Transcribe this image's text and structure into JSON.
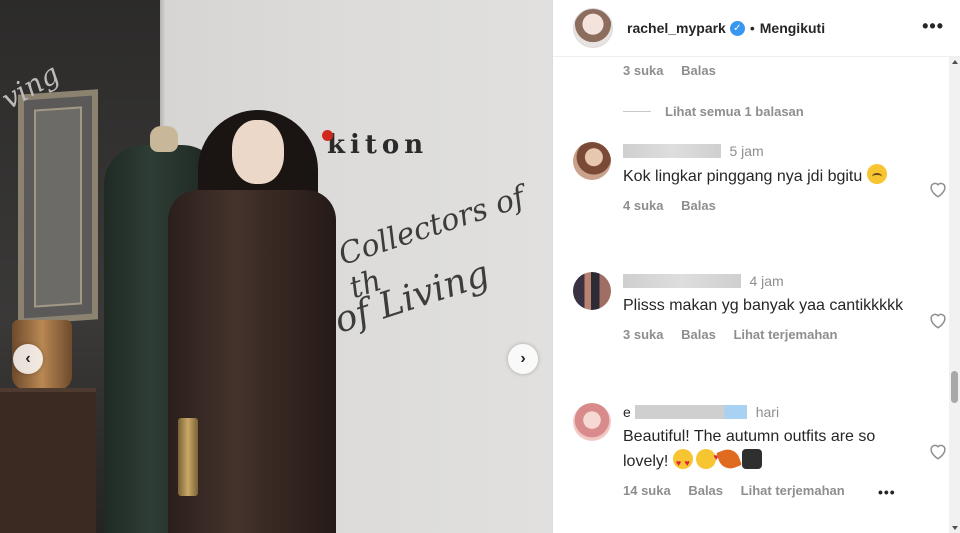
{
  "photo": {
    "brand_text": "kiton",
    "script_line_1": "Collectors of th",
    "script_line_2": "e of Living",
    "script_line_3": "ving",
    "prev_icon": "chevron-left-icon",
    "next_icon": "chevron-right-icon"
  },
  "header": {
    "username": "rachel_mypark",
    "verified_icon": "verified-badge-icon",
    "separator": "•",
    "follow_label": "Mengikuti",
    "more_icon": "more-options-icon"
  },
  "top_reply": {
    "likes": "3 suka",
    "reply": "Balas",
    "view_replies": "Lihat semua 1 balasan"
  },
  "comments": [
    {
      "time": "5 jam",
      "text": "Kok lingkar pinggang nya jdi bgitu",
      "emojis": [
        "frowning-face"
      ],
      "likes": "4 suka",
      "reply": "Balas",
      "translate": ""
    },
    {
      "time": "4 jam",
      "text": "Plisss makan yg banyak yaa cantikkkkk",
      "emojis": [],
      "likes": "3 suka",
      "reply": "Balas",
      "translate": "Lihat terjemahan"
    },
    {
      "username_fragment": "e",
      "time": "hari",
      "text": "Beautiful! The autumn outfits are so lovely!",
      "emojis": [
        "heart-eyes",
        "kissing-heart",
        "fallen-leaf",
        "coat"
      ],
      "likes": "14 suka",
      "reply": "Balas",
      "translate": "Lihat terjemahan",
      "more": "•••"
    }
  ],
  "colors": {
    "text_primary": "#262626",
    "text_secondary": "#8e8e8e",
    "verified_blue": "#3897f0",
    "brand_red": "#d02a1e"
  }
}
